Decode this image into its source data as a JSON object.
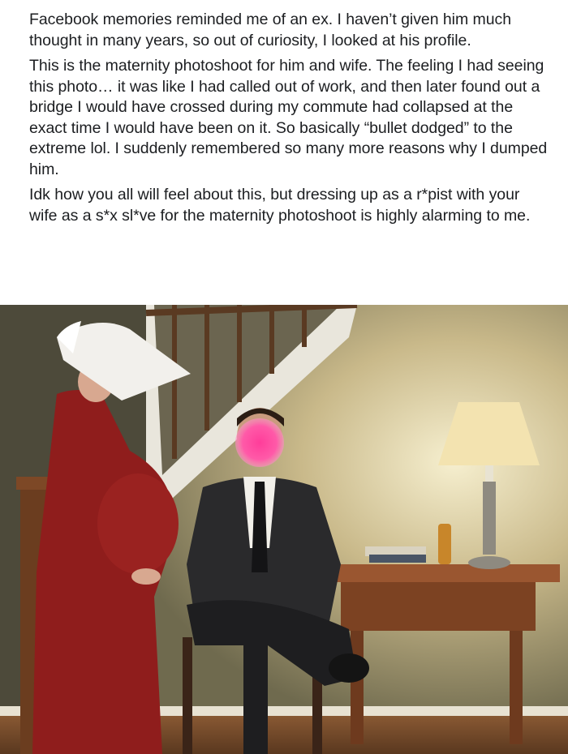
{
  "post": {
    "paragraphs": [
      "Facebook memories reminded me of an ex. I haven’t given him much thought in many years, so out of curiosity, I looked at his profile.",
      "This is the maternity photoshoot for him and wife. The feeling I had seeing this photo… it was like I had called out of work, and then later found out a bridge I would have crossed during my commute had collapsed at the exact time I would have been on it. So basically “bullet dodged” to the extreme lol. I suddenly remembered so many more reasons why I dumped him.",
      "Idk how you all will feel about this, but dressing up as a r*pist with your wife as a s*x sl*ve for the maternity photoshoot is highly alarming to me."
    ]
  },
  "colors": {
    "text": "#1c1e21",
    "wall": "#8b8463",
    "dress": "#8f1d1c",
    "bonnet": "#f2f0ec",
    "suit": "#2a2a2c",
    "desk": "#8a4a25",
    "lampshade": "#f3e3b0",
    "face_blur": "#ff3d9a"
  }
}
